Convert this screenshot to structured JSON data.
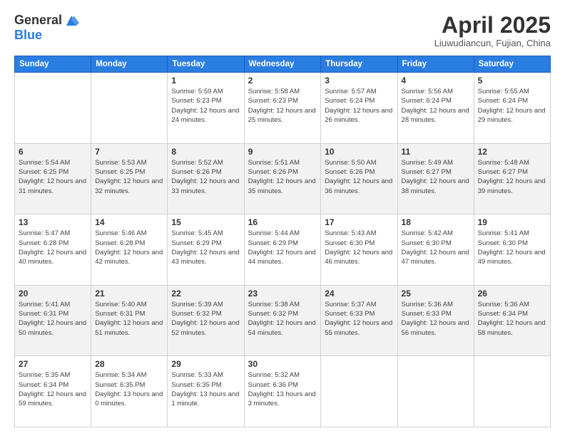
{
  "header": {
    "logo_general": "General",
    "logo_blue": "Blue",
    "title": "April 2025",
    "location": "Liuwudiancun, Fujian, China"
  },
  "weekdays": [
    "Sunday",
    "Monday",
    "Tuesday",
    "Wednesday",
    "Thursday",
    "Friday",
    "Saturday"
  ],
  "weeks": [
    [
      {
        "day": "",
        "info": ""
      },
      {
        "day": "",
        "info": ""
      },
      {
        "day": "1",
        "info": "Sunrise: 5:59 AM\nSunset: 6:23 PM\nDaylight: 12 hours and 24 minutes."
      },
      {
        "day": "2",
        "info": "Sunrise: 5:58 AM\nSunset: 6:23 PM\nDaylight: 12 hours and 25 minutes."
      },
      {
        "day": "3",
        "info": "Sunrise: 5:57 AM\nSunset: 6:24 PM\nDaylight: 12 hours and 26 minutes."
      },
      {
        "day": "4",
        "info": "Sunrise: 5:56 AM\nSunset: 6:24 PM\nDaylight: 12 hours and 28 minutes."
      },
      {
        "day": "5",
        "info": "Sunrise: 5:55 AM\nSunset: 6:24 PM\nDaylight: 12 hours and 29 minutes."
      }
    ],
    [
      {
        "day": "6",
        "info": "Sunrise: 5:54 AM\nSunset: 6:25 PM\nDaylight: 12 hours and 31 minutes."
      },
      {
        "day": "7",
        "info": "Sunrise: 5:53 AM\nSunset: 6:25 PM\nDaylight: 12 hours and 32 minutes."
      },
      {
        "day": "8",
        "info": "Sunrise: 5:52 AM\nSunset: 6:26 PM\nDaylight: 12 hours and 33 minutes."
      },
      {
        "day": "9",
        "info": "Sunrise: 5:51 AM\nSunset: 6:26 PM\nDaylight: 12 hours and 35 minutes."
      },
      {
        "day": "10",
        "info": "Sunrise: 5:50 AM\nSunset: 6:26 PM\nDaylight: 12 hours and 36 minutes."
      },
      {
        "day": "11",
        "info": "Sunrise: 5:49 AM\nSunset: 6:27 PM\nDaylight: 12 hours and 38 minutes."
      },
      {
        "day": "12",
        "info": "Sunrise: 5:48 AM\nSunset: 6:27 PM\nDaylight: 12 hours and 39 minutes."
      }
    ],
    [
      {
        "day": "13",
        "info": "Sunrise: 5:47 AM\nSunset: 6:28 PM\nDaylight: 12 hours and 40 minutes."
      },
      {
        "day": "14",
        "info": "Sunrise: 5:46 AM\nSunset: 6:28 PM\nDaylight: 12 hours and 42 minutes."
      },
      {
        "day": "15",
        "info": "Sunrise: 5:45 AM\nSunset: 6:29 PM\nDaylight: 12 hours and 43 minutes."
      },
      {
        "day": "16",
        "info": "Sunrise: 5:44 AM\nSunset: 6:29 PM\nDaylight: 12 hours and 44 minutes."
      },
      {
        "day": "17",
        "info": "Sunrise: 5:43 AM\nSunset: 6:30 PM\nDaylight: 12 hours and 46 minutes."
      },
      {
        "day": "18",
        "info": "Sunrise: 5:42 AM\nSunset: 6:30 PM\nDaylight: 12 hours and 47 minutes."
      },
      {
        "day": "19",
        "info": "Sunrise: 5:41 AM\nSunset: 6:30 PM\nDaylight: 12 hours and 49 minutes."
      }
    ],
    [
      {
        "day": "20",
        "info": "Sunrise: 5:41 AM\nSunset: 6:31 PM\nDaylight: 12 hours and 50 minutes."
      },
      {
        "day": "21",
        "info": "Sunrise: 5:40 AM\nSunset: 6:31 PM\nDaylight: 12 hours and 51 minutes."
      },
      {
        "day": "22",
        "info": "Sunrise: 5:39 AM\nSunset: 6:32 PM\nDaylight: 12 hours and 52 minutes."
      },
      {
        "day": "23",
        "info": "Sunrise: 5:38 AM\nSunset: 6:32 PM\nDaylight: 12 hours and 54 minutes."
      },
      {
        "day": "24",
        "info": "Sunrise: 5:37 AM\nSunset: 6:33 PM\nDaylight: 12 hours and 55 minutes."
      },
      {
        "day": "25",
        "info": "Sunrise: 5:36 AM\nSunset: 6:33 PM\nDaylight: 12 hours and 56 minutes."
      },
      {
        "day": "26",
        "info": "Sunrise: 5:36 AM\nSunset: 6:34 PM\nDaylight: 12 hours and 58 minutes."
      }
    ],
    [
      {
        "day": "27",
        "info": "Sunrise: 5:35 AM\nSunset: 6:34 PM\nDaylight: 12 hours and 59 minutes."
      },
      {
        "day": "28",
        "info": "Sunrise: 5:34 AM\nSunset: 6:35 PM\nDaylight: 13 hours and 0 minutes."
      },
      {
        "day": "29",
        "info": "Sunrise: 5:33 AM\nSunset: 6:35 PM\nDaylight: 13 hours and 1 minute."
      },
      {
        "day": "30",
        "info": "Sunrise: 5:32 AM\nSunset: 6:36 PM\nDaylight: 13 hours and 3 minutes."
      },
      {
        "day": "",
        "info": ""
      },
      {
        "day": "",
        "info": ""
      },
      {
        "day": "",
        "info": ""
      }
    ]
  ]
}
